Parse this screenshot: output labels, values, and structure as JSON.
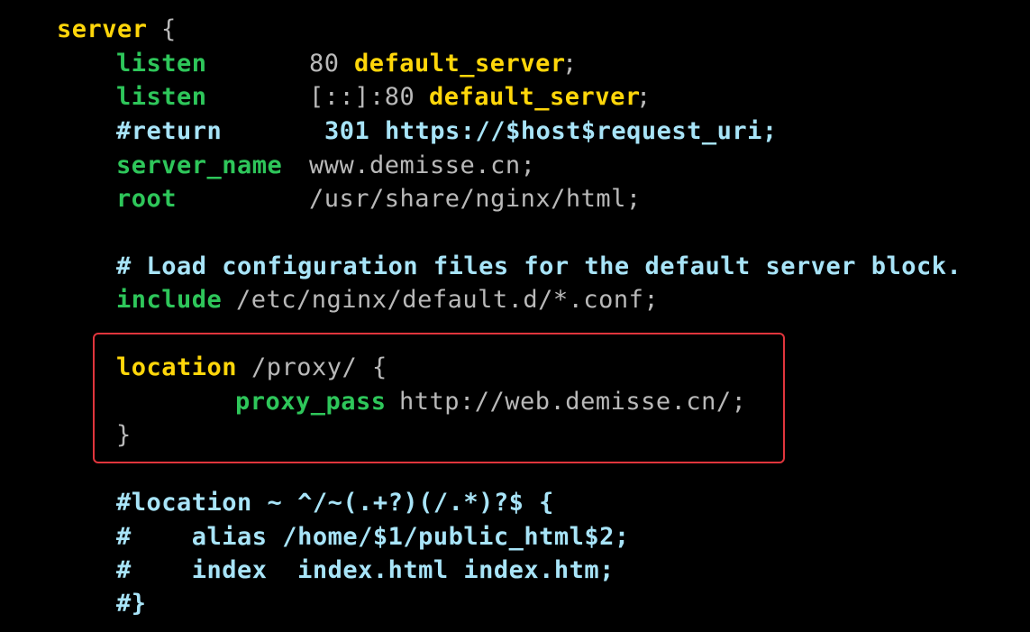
{
  "code": {
    "server_kw": "server",
    "open_brace": "{",
    "listen1": {
      "directive": "listen",
      "port": "80",
      "flag": "default_server",
      "semi": ";"
    },
    "listen2": {
      "directive": "listen",
      "port": "[::]:80",
      "flag": "default_server",
      "semi": ";"
    },
    "return_comment": {
      "directive": "#return",
      "rest": "301 https://$host$request_uri;"
    },
    "server_name": {
      "directive": "server_name",
      "value": "www.demisse.cn;"
    },
    "root": {
      "directive": "root",
      "value": "/usr/share/nginx/html;"
    },
    "load_comment": "# Load configuration files for the default server block.",
    "include": {
      "directive": "include",
      "value": "/etc/nginx/default.d/*.conf;"
    },
    "location": {
      "directive": "location",
      "value": "/proxy/ {"
    },
    "proxy_pass": {
      "directive": "proxy_pass",
      "value": "http://web.demisse.cn/;"
    },
    "close_brace": "}",
    "commented_location": [
      "#location ~ ^/~(.+?)(/.*)?$ {",
      "#    alias /home/$1/public_html$2;",
      "#    index  index.html index.htm;",
      "#}"
    ]
  },
  "colors": {
    "background": "#000000",
    "keyword": "#ffd60a",
    "directive": "#2ec65a",
    "value": "#b9b9b9",
    "comment": "#a8e4f8",
    "highlight_border": "#e0353c"
  }
}
